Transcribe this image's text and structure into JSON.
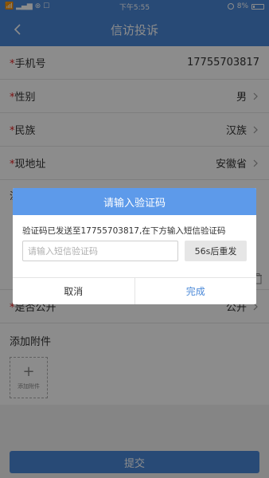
{
  "status_bar": {
    "left": "",
    "time": "下午5:55",
    "battery": "8%"
  },
  "header": {
    "title": "信访投诉"
  },
  "form": {
    "phone_label": "手机号",
    "phone_value": "17755703817",
    "gender_label": "性别",
    "gender_value": "男",
    "ethnicity_label": "民族",
    "ethnicity_value": "汉族",
    "address_label": "现地址",
    "address_value": "安徽省",
    "notice": "注意:此处请填写详细住址",
    "public_label": "是否公开",
    "public_value": "公开",
    "attach_label": "添加附件",
    "attach_button": "添加附件",
    "required_mark": "*"
  },
  "submit_label": "提交",
  "dialog": {
    "title": "请输入验证码",
    "message": "验证码已发送至17755703817,在下方输入短信验证码",
    "input_placeholder": "请输入短信验证码",
    "input_value": "",
    "resend_label": "56s后重发",
    "cancel_label": "取消",
    "confirm_label": "完成"
  },
  "colors": {
    "primary": "#4a88d8",
    "dialog_header": "#5d9aea",
    "required": "#e02020"
  }
}
